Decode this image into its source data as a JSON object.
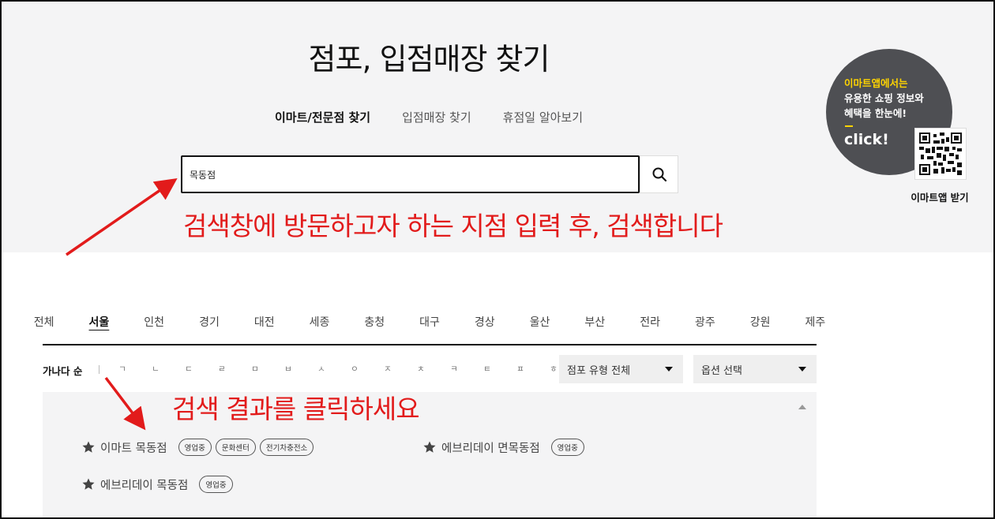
{
  "page_title": "점포, 입점매장 찾기",
  "tabs": [
    {
      "label": "이마트/전문점 찾기",
      "active": true
    },
    {
      "label": "입점매장 찾기",
      "active": false
    },
    {
      "label": "휴점일 알아보기",
      "active": false
    }
  ],
  "search": {
    "value": "목동점",
    "button_icon": "search-icon"
  },
  "annotations": {
    "search_hint": "검색창에 방문하고자 하는 지점 입력 후, 검색합니다",
    "result_hint": "검색 결과를 클릭하세요",
    "color": "#e21b1b"
  },
  "promo": {
    "line1": "이마트앱에서는",
    "line2": "유용한 쇼핑 정보와",
    "line3": "혜택을 한눈에!",
    "click": "click!",
    "qr_label": "이마트앱 받기",
    "accent": "#ffd400",
    "bg": "#4e4f53"
  },
  "regions": [
    {
      "label": "전체"
    },
    {
      "label": "서울",
      "active": true
    },
    {
      "label": "인천"
    },
    {
      "label": "경기"
    },
    {
      "label": "대전"
    },
    {
      "label": "세종"
    },
    {
      "label": "충청"
    },
    {
      "label": "대구"
    },
    {
      "label": "경상"
    },
    {
      "label": "울산"
    },
    {
      "label": "부산"
    },
    {
      "label": "전라"
    },
    {
      "label": "광주"
    },
    {
      "label": "강원"
    },
    {
      "label": "제주"
    }
  ],
  "sort": {
    "label": "가나다 순",
    "consonants": [
      "ㄱ",
      "ㄴ",
      "ㄷ",
      "ㄹ",
      "ㅁ",
      "ㅂ",
      "ㅅ",
      "ㅇ",
      "ㅈ",
      "ㅊ",
      "ㅋ",
      "ㅌ",
      "ㅍ",
      "ㅎ"
    ]
  },
  "filters": {
    "store_type": "점포 유형 전체",
    "option": "옵션 선택"
  },
  "results": [
    {
      "name": "이마트 목동점",
      "badges": [
        "영업중",
        "문화센터",
        "전기차충전소"
      ]
    },
    {
      "name": "에브리데이 면목동점",
      "badges": [
        "영업중"
      ]
    },
    {
      "name": "에브리데이 목동점",
      "badges": [
        "영업중"
      ]
    }
  ]
}
